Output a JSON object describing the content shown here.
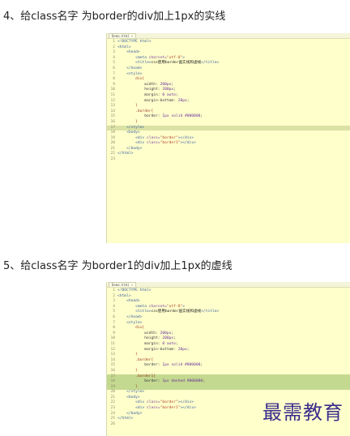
{
  "headings": {
    "step4": "4、给class名字 为border的div加上1px的实线",
    "step5": "5、给class名字 为border1的div加上1px的虚线"
  },
  "editor1": {
    "tab_label": "Demo.html",
    "close_glyph": "×",
    "highlight_line": 17,
    "lines": [
      {
        "n": "1",
        "segs": [
          {
            "t": "<!DOCTYPE html>",
            "c": "tag"
          }
        ]
      },
      {
        "n": "2",
        "segs": [
          {
            "t": "<html>",
            "c": "tag"
          }
        ]
      },
      {
        "n": "3",
        "segs": [
          {
            "t": "    <head>",
            "c": "tag"
          }
        ]
      },
      {
        "n": "4",
        "segs": [
          {
            "t": "        <meta ",
            "c": "tag"
          },
          {
            "t": "charset=",
            "c": "attr"
          },
          {
            "t": "\"utf-8\"",
            "c": "str"
          },
          {
            "t": ">",
            "c": "tag"
          }
        ]
      },
      {
        "n": "5",
        "segs": [
          {
            "t": "        <title>",
            "c": "tag"
          },
          {
            "t": "css使用border画实线和虚线",
            "c": "txt"
          },
          {
            "t": "</title>",
            "c": "tag"
          }
        ]
      },
      {
        "n": "6",
        "segs": [
          {
            "t": "    </head>",
            "c": "tag"
          }
        ]
      },
      {
        "n": "7",
        "segs": [
          {
            "t": "    <style>",
            "c": "tag"
          }
        ]
      },
      {
        "n": "8",
        "segs": [
          {
            "t": "        div{",
            "c": "sel"
          }
        ]
      },
      {
        "n": "9",
        "segs": [
          {
            "t": "            width: ",
            "c": "prop"
          },
          {
            "t": "200px",
            "c": "num"
          },
          {
            "t": ";",
            "c": "prop"
          }
        ]
      },
      {
        "n": "10",
        "segs": [
          {
            "t": "            height: ",
            "c": "prop"
          },
          {
            "t": "200px",
            "c": "num"
          },
          {
            "t": ";",
            "c": "prop"
          }
        ]
      },
      {
        "n": "11",
        "segs": [
          {
            "t": "            margin: ",
            "c": "prop"
          },
          {
            "t": "0 auto",
            "c": "num"
          },
          {
            "t": ";",
            "c": "prop"
          }
        ]
      },
      {
        "n": "12",
        "segs": [
          {
            "t": "            margin-bottom: ",
            "c": "prop"
          },
          {
            "t": "20px",
            "c": "num"
          },
          {
            "t": ";",
            "c": "prop"
          }
        ]
      },
      {
        "n": "13",
        "segs": [
          {
            "t": "        }",
            "c": "sel"
          }
        ]
      },
      {
        "n": "14",
        "segs": [
          {
            "t": "        .border{",
            "c": "sel"
          }
        ]
      },
      {
        "n": "15",
        "segs": [
          {
            "t": "            border: ",
            "c": "prop"
          },
          {
            "t": "1px solid #000000",
            "c": "num"
          },
          {
            "t": ";",
            "c": "prop"
          }
        ]
      },
      {
        "n": "16",
        "segs": [
          {
            "t": "        }",
            "c": "sel"
          }
        ]
      },
      {
        "n": "17",
        "segs": [
          {
            "t": "    </style>",
            "c": "tag"
          }
        ]
      },
      {
        "n": "18",
        "segs": [
          {
            "t": "    <body>",
            "c": "tag"
          }
        ]
      },
      {
        "n": "19",
        "segs": [
          {
            "t": "        <div ",
            "c": "tag"
          },
          {
            "t": "class=",
            "c": "attr"
          },
          {
            "t": "\"border\"",
            "c": "str"
          },
          {
            "t": "></div>",
            "c": "tag"
          }
        ]
      },
      {
        "n": "20",
        "segs": [
          {
            "t": "        <div ",
            "c": "tag"
          },
          {
            "t": "class=",
            "c": "attr"
          },
          {
            "t": "\"border1\"",
            "c": "str"
          },
          {
            "t": "></div>",
            "c": "tag"
          }
        ]
      },
      {
        "n": "21",
        "segs": [
          {
            "t": "    </body>",
            "c": "tag"
          }
        ]
      },
      {
        "n": "22",
        "segs": [
          {
            "t": "</html>",
            "c": "tag"
          }
        ]
      },
      {
        "n": "23",
        "segs": []
      }
    ]
  },
  "editor2": {
    "tab_label": "Demo.html",
    "close_glyph": "×",
    "highlight_lines": [
      17,
      18,
      19
    ],
    "lines": [
      {
        "n": "1",
        "segs": [
          {
            "t": "<!DOCTYPE html>",
            "c": "tag"
          }
        ]
      },
      {
        "n": "2",
        "segs": [
          {
            "t": "<html>",
            "c": "tag"
          }
        ]
      },
      {
        "n": "3",
        "segs": [
          {
            "t": "    <head>",
            "c": "tag"
          }
        ]
      },
      {
        "n": "4",
        "segs": [
          {
            "t": "        <meta ",
            "c": "tag"
          },
          {
            "t": "charset=",
            "c": "attr"
          },
          {
            "t": "\"utf-8\"",
            "c": "str"
          },
          {
            "t": ">",
            "c": "tag"
          }
        ]
      },
      {
        "n": "5",
        "segs": [
          {
            "t": "        <title>",
            "c": "tag"
          },
          {
            "t": "css使用border画实线和虚线",
            "c": "txt"
          },
          {
            "t": "</title>",
            "c": "tag"
          }
        ]
      },
      {
        "n": "6",
        "segs": [
          {
            "t": "    </head>",
            "c": "tag"
          }
        ]
      },
      {
        "n": "7",
        "segs": [
          {
            "t": "    <style>",
            "c": "tag"
          }
        ]
      },
      {
        "n": "8",
        "segs": [
          {
            "t": "        div{",
            "c": "sel"
          }
        ]
      },
      {
        "n": "9",
        "segs": [
          {
            "t": "            width: ",
            "c": "prop"
          },
          {
            "t": "200px",
            "c": "num"
          },
          {
            "t": ";",
            "c": "prop"
          }
        ]
      },
      {
        "n": "10",
        "segs": [
          {
            "t": "            height: ",
            "c": "prop"
          },
          {
            "t": "200px",
            "c": "num"
          },
          {
            "t": ";",
            "c": "prop"
          }
        ]
      },
      {
        "n": "11",
        "segs": [
          {
            "t": "            margin: ",
            "c": "prop"
          },
          {
            "t": "0 auto",
            "c": "num"
          },
          {
            "t": ";",
            "c": "prop"
          }
        ]
      },
      {
        "n": "12",
        "segs": [
          {
            "t": "            margin-bottom: ",
            "c": "prop"
          },
          {
            "t": "20px",
            "c": "num"
          },
          {
            "t": ";",
            "c": "prop"
          }
        ]
      },
      {
        "n": "13",
        "segs": [
          {
            "t": "        }",
            "c": "sel"
          }
        ]
      },
      {
        "n": "14",
        "segs": [
          {
            "t": "        .border{",
            "c": "sel"
          }
        ]
      },
      {
        "n": "15",
        "segs": [
          {
            "t": "            border: ",
            "c": "prop"
          },
          {
            "t": "1px solid #000000",
            "c": "num"
          },
          {
            "t": ";",
            "c": "prop"
          }
        ]
      },
      {
        "n": "16",
        "segs": [
          {
            "t": "        }",
            "c": "sel"
          }
        ]
      },
      {
        "n": "17",
        "segs": [
          {
            "t": "        .border1{",
            "c": "sel"
          }
        ]
      },
      {
        "n": "18",
        "segs": [
          {
            "t": "            border: ",
            "c": "prop"
          },
          {
            "t": "1px dashed #000000",
            "c": "num"
          },
          {
            "t": ";",
            "c": "prop"
          }
        ]
      },
      {
        "n": "19",
        "segs": [
          {
            "t": "        }",
            "c": "sel"
          }
        ]
      },
      {
        "n": "20",
        "segs": [
          {
            "t": "    </style>",
            "c": "tag"
          }
        ]
      },
      {
        "n": "21",
        "segs": [
          {
            "t": "    <body>",
            "c": "tag"
          }
        ]
      },
      {
        "n": "22",
        "segs": [
          {
            "t": "        <div ",
            "c": "tag"
          },
          {
            "t": "class=",
            "c": "attr"
          },
          {
            "t": "\"border\"",
            "c": "str"
          },
          {
            "t": "></div>",
            "c": "tag"
          }
        ]
      },
      {
        "n": "23",
        "segs": [
          {
            "t": "        <div ",
            "c": "tag"
          },
          {
            "t": "class=",
            "c": "attr"
          },
          {
            "t": "\"border1\"",
            "c": "str"
          },
          {
            "t": "></div>",
            "c": "tag"
          }
        ]
      },
      {
        "n": "24",
        "segs": [
          {
            "t": "    </body>",
            "c": "tag"
          }
        ]
      },
      {
        "n": "25",
        "segs": [
          {
            "t": "</html>",
            "c": "tag"
          }
        ]
      },
      {
        "n": "26",
        "segs": []
      }
    ]
  },
  "watermark": "最需教育"
}
